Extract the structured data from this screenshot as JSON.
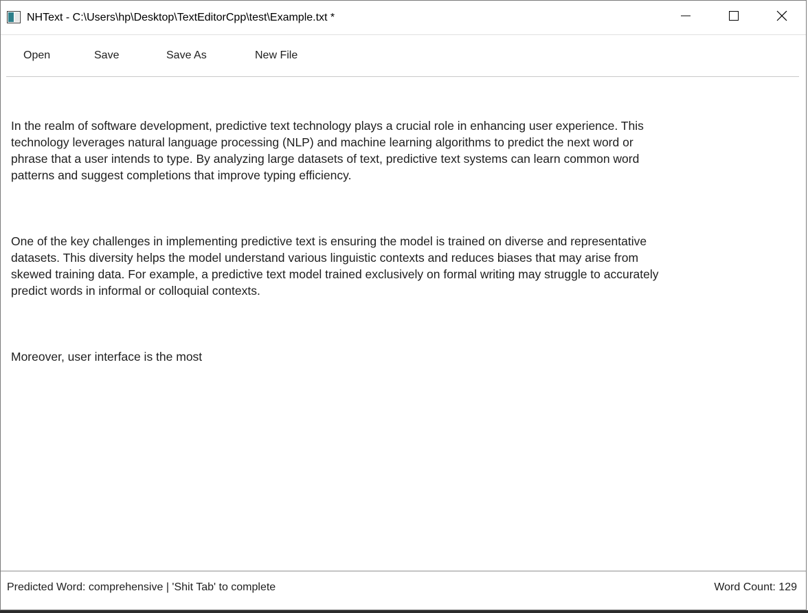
{
  "window": {
    "title": "NHText - C:\\Users\\hp\\Desktop\\TextEditorCpp\\test\\Example.txt *",
    "app_icon": "app-window-icon",
    "controls": {
      "minimize_icon": "minimize-icon",
      "maximize_icon": "maximize-icon",
      "close_icon": "close-icon"
    }
  },
  "toolbar": {
    "open_label": "Open",
    "save_label": "Save",
    "save_as_label": "Save As",
    "new_file_label": "New File"
  },
  "editor": {
    "paragraphs": [
      "In the realm of software development, predictive text technology plays a crucial role in enhancing user experience. This\ntechnology leverages natural language processing (NLP) and machine learning algorithms to predict the next word or\nphrase that a user intends to type. By analyzing large datasets of text, predictive text systems can learn common word\npatterns and suggest completions that improve typing efficiency.",
      "One of the key challenges in implementing predictive text is ensuring the model is trained on diverse and representative\n datasets. This diversity helps the model understand various linguistic contexts and reduces biases that may arise from\nskewed training data. For example, a predictive text model trained exclusively on formal writing may struggle to accurately\npredict words in informal or colloquial contexts.",
      "Moreover, user interface is the most"
    ]
  },
  "status": {
    "prediction_text": "Predicted Word: comprehensive | 'Shit Tab' to complete",
    "word_count_text": "Word Count: 129"
  },
  "colors": {
    "text": "#1e1e1e",
    "divider": "#c8c8c8",
    "background": "#ffffff"
  }
}
